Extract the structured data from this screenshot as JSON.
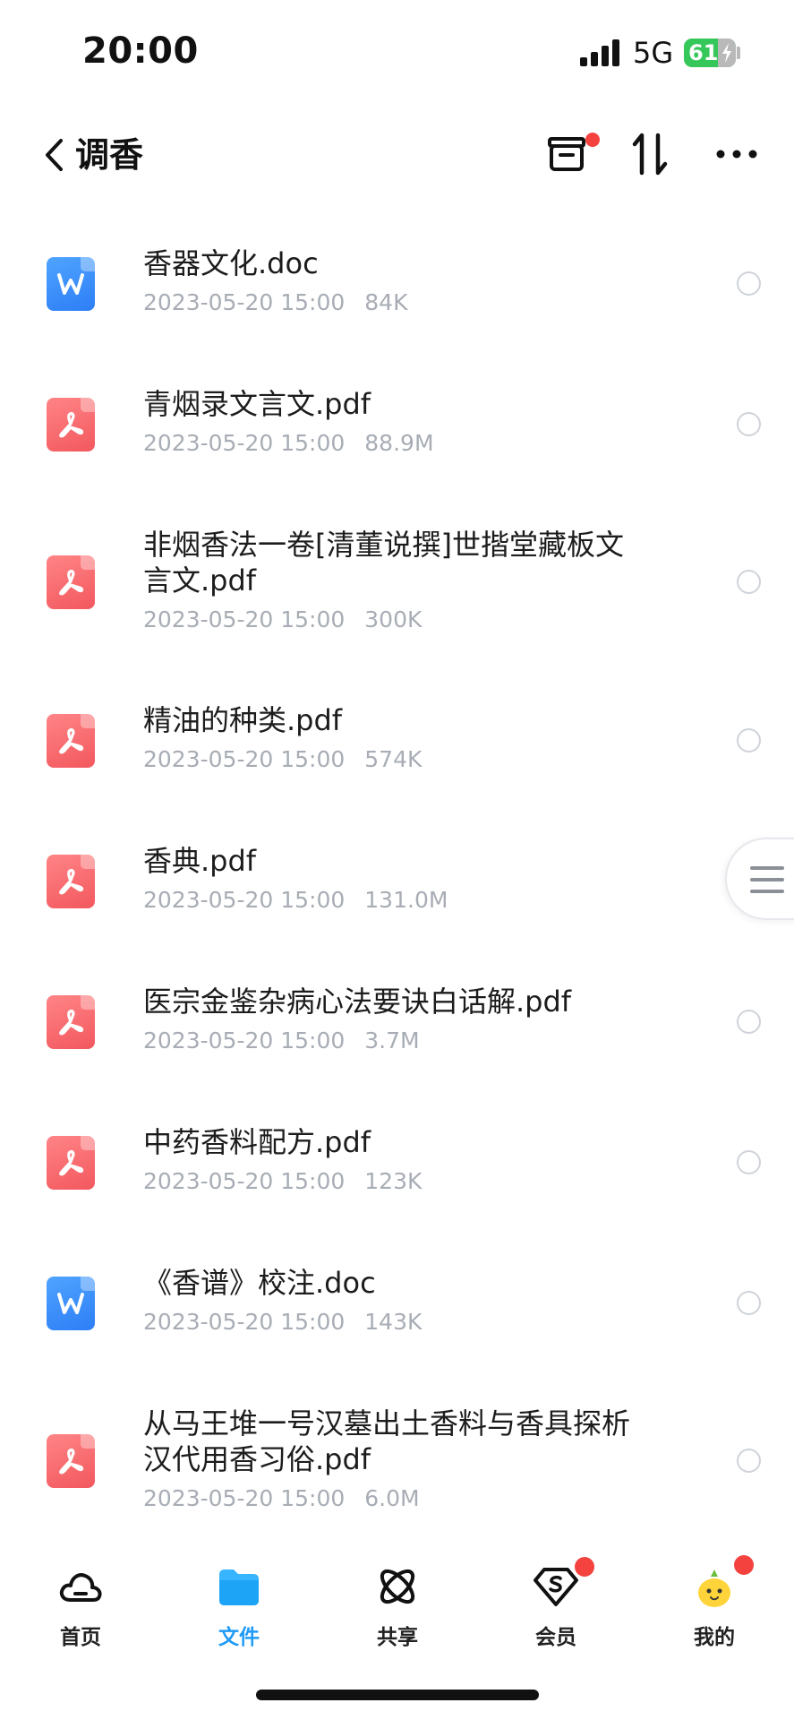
{
  "status_bar": {
    "time": "20:00",
    "network": "5G",
    "battery": "61"
  },
  "header": {
    "back_icon": "chevron-left-icon",
    "title": "调香",
    "actions": [
      "archive-box-icon",
      "sort-icon",
      "more-icon"
    ]
  },
  "files": [
    {
      "name": "香器文化.doc",
      "date": "2023-05-20 15:00",
      "size": "84K",
      "type": "doc"
    },
    {
      "name": "青烟录文言文.pdf",
      "date": "2023-05-20 15:00",
      "size": "88.9M",
      "type": "pdf"
    },
    {
      "name": "非烟香法一卷[清董说撰]世揩堂藏板文言文.pdf",
      "date": "2023-05-20 15:00",
      "size": "300K",
      "type": "pdf"
    },
    {
      "name": "精油的种类.pdf",
      "date": "2023-05-20 15:00",
      "size": "574K",
      "type": "pdf"
    },
    {
      "name": "香典.pdf",
      "date": "2023-05-20 15:00",
      "size": "131.0M",
      "type": "pdf"
    },
    {
      "name": "医宗金鉴杂病心法要诀白话解.pdf",
      "date": "2023-05-20 15:00",
      "size": "3.7M",
      "type": "pdf"
    },
    {
      "name": "中药香料配方.pdf",
      "date": "2023-05-20 15:00",
      "size": "123K",
      "type": "pdf"
    },
    {
      "name": "《香谱》校注.doc",
      "date": "2023-05-20 15:00",
      "size": "143K",
      "type": "doc"
    },
    {
      "name": "从马王堆一号汉墓出土香料与香具探析汉代用香习俗.pdf",
      "date": "2023-05-20 15:00",
      "size": "6.0M",
      "type": "pdf"
    }
  ],
  "tabs": [
    {
      "label": "首页",
      "icon": "cloud-icon",
      "active": false
    },
    {
      "label": "文件",
      "icon": "folder-icon",
      "active": true
    },
    {
      "label": "共享",
      "icon": "share-atom-icon",
      "active": false
    },
    {
      "label": "会员",
      "icon": "vip-diamond-icon",
      "active": false
    },
    {
      "label": "我的",
      "icon": "avatar-icon",
      "active": false
    }
  ],
  "colors": {
    "accent": "#1f9bf6",
    "badge": "#f4433f",
    "doc_icon": "#2d7ef6",
    "pdf_icon": "#f2585e",
    "meta_text": "#a8adb5"
  }
}
